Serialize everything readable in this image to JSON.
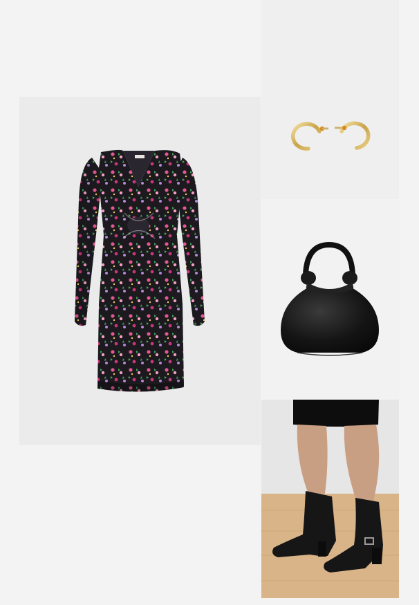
{
  "outfit": {
    "items": [
      {
        "name": "dress",
        "icon": "floral-wrap-dress-image"
      },
      {
        "name": "earrings",
        "icon": "gold-hoop-earrings-image"
      },
      {
        "name": "bag",
        "icon": "black-knot-handle-bag-image"
      },
      {
        "name": "boots",
        "icon": "black-western-ankle-boots-image"
      }
    ]
  },
  "colors": {
    "page_background": "#f3f3f3",
    "dress_base": "#1c1a1f",
    "floral_pink": "#e5588f",
    "floral_green": "#3f9b56",
    "gold": "#d4b45a",
    "bag_black": "#141414",
    "floor_wood": "#d8b488"
  }
}
